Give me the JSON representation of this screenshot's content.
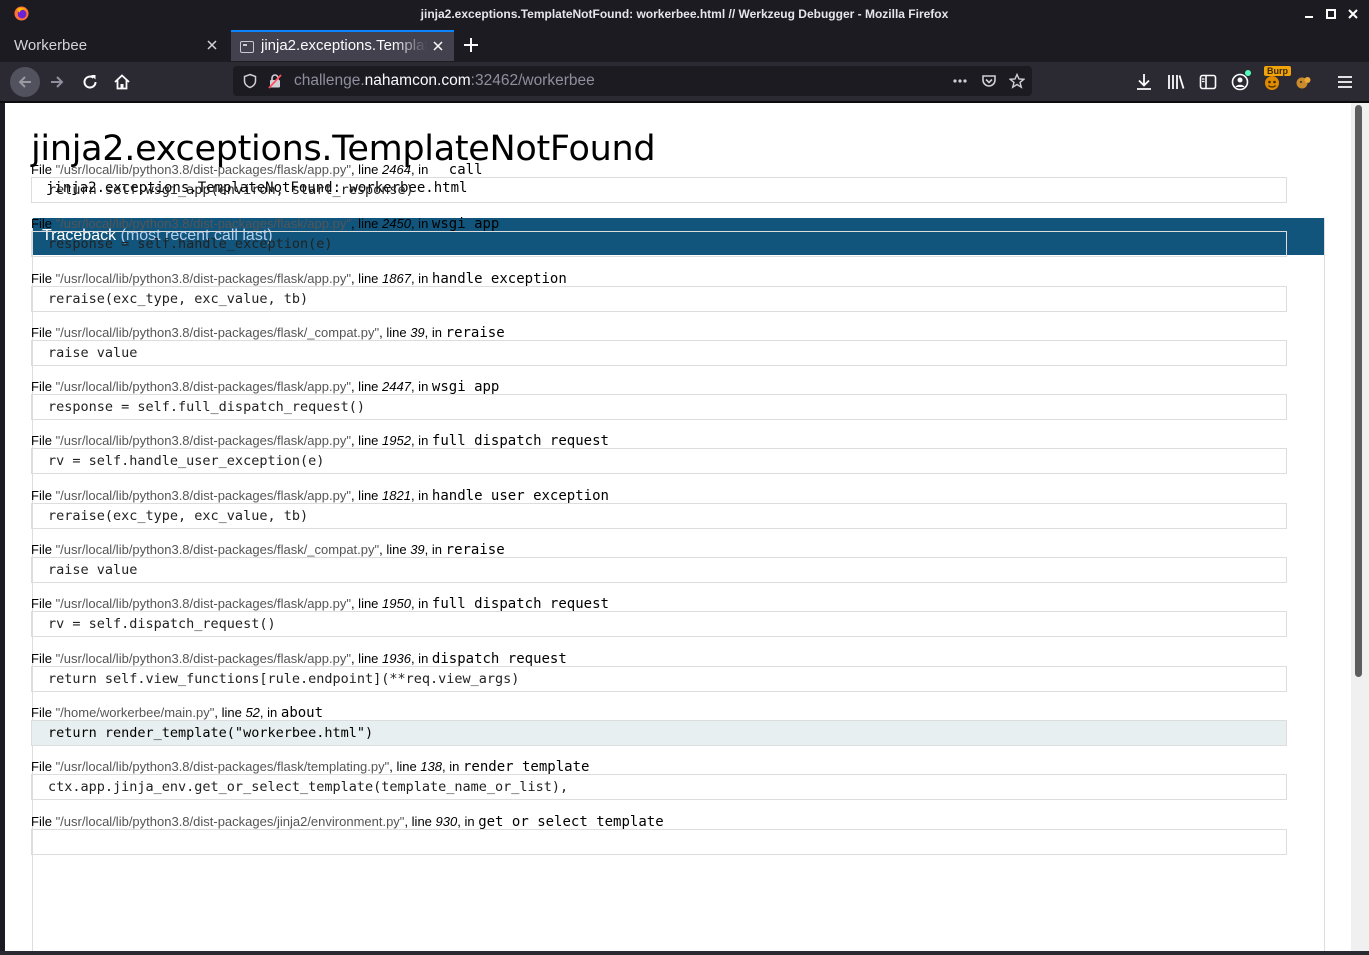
{
  "window": {
    "title": "jinja2.exceptions.TemplateNotFound: workerbee.html // Werkzeug Debugger - Mozilla Firefox"
  },
  "tabs": [
    {
      "label": "Workerbee",
      "active": false
    },
    {
      "label": "jinja2.exceptions.TemplateNotFound",
      "active": true
    }
  ],
  "urlbar": {
    "prefix": "challenge.",
    "host": "nahamcon.com",
    "suffix": ":32462/workerbee"
  },
  "toolbar": {
    "burp_badge": "Burp"
  },
  "page": {
    "title": "jinja2.exceptions.TemplateNotFound",
    "message": "jinja2.exceptions.TemplateNotFound: workerbee.html",
    "traceback_label": "Traceback",
    "traceback_sub": "(most recent call last)",
    "frames": [
      {
        "file": "\"/usr/local/lib/python3.8/dist-packages/flask/app.py\"",
        "line": "2464",
        "func": "__call__",
        "source": "return self.wsgi_app(environ, start_response)",
        "current": false
      },
      {
        "file": "\"/usr/local/lib/python3.8/dist-packages/flask/app.py\"",
        "line": "2450",
        "func": "wsgi_app",
        "source": "response = self.handle_exception(e)",
        "current": false
      },
      {
        "file": "\"/usr/local/lib/python3.8/dist-packages/flask/app.py\"",
        "line": "1867",
        "func": "handle_exception",
        "source": "reraise(exc_type, exc_value, tb)",
        "current": false
      },
      {
        "file": "\"/usr/local/lib/python3.8/dist-packages/flask/_compat.py\"",
        "line": "39",
        "func": "reraise",
        "source": "raise value",
        "current": false
      },
      {
        "file": "\"/usr/local/lib/python3.8/dist-packages/flask/app.py\"",
        "line": "2447",
        "func": "wsgi_app",
        "source": "response = self.full_dispatch_request()",
        "current": false
      },
      {
        "file": "\"/usr/local/lib/python3.8/dist-packages/flask/app.py\"",
        "line": "1952",
        "func": "full_dispatch_request",
        "source": "rv = self.handle_user_exception(e)",
        "current": false
      },
      {
        "file": "\"/usr/local/lib/python3.8/dist-packages/flask/app.py\"",
        "line": "1821",
        "func": "handle_user_exception",
        "source": "reraise(exc_type, exc_value, tb)",
        "current": false
      },
      {
        "file": "\"/usr/local/lib/python3.8/dist-packages/flask/_compat.py\"",
        "line": "39",
        "func": "reraise",
        "source": "raise value",
        "current": false
      },
      {
        "file": "\"/usr/local/lib/python3.8/dist-packages/flask/app.py\"",
        "line": "1950",
        "func": "full_dispatch_request",
        "source": "rv = self.dispatch_request()",
        "current": false
      },
      {
        "file": "\"/usr/local/lib/python3.8/dist-packages/flask/app.py\"",
        "line": "1936",
        "func": "dispatch_request",
        "source": "return self.view_functions[rule.endpoint](**req.view_args)",
        "current": false
      },
      {
        "file": "\"/home/workerbee/main.py\"",
        "line": "52",
        "func": "about",
        "source": "return render_template(\"workerbee.html\")",
        "current": true
      },
      {
        "file": "\"/usr/local/lib/python3.8/dist-packages/flask/templating.py\"",
        "line": "138",
        "func": "render_template",
        "source": "ctx.app.jinja_env.get_or_select_template(template_name_or_list),",
        "current": false
      },
      {
        "file": "\"/usr/local/lib/python3.8/dist-packages/jinja2/environment.py\"",
        "line": "930",
        "func": "get_or_select_template",
        "source": "",
        "current": false
      }
    ]
  },
  "labels": {
    "file_prefix": "File ",
    "line_prefix": ", line ",
    "in_prefix": ", in "
  }
}
